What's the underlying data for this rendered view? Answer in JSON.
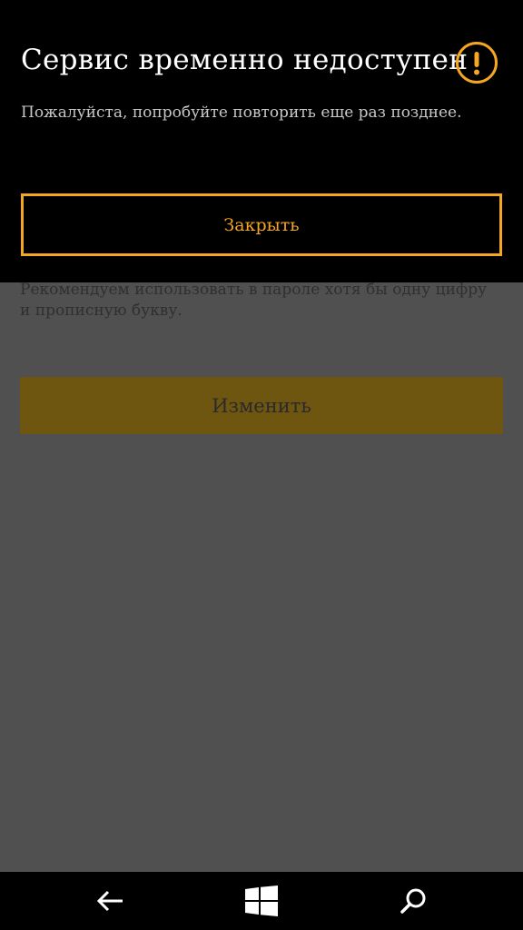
{
  "background_page": {
    "hint_text": "Рекомендуем использовать в пароле хотя бы одну цифру и прописную букву.",
    "change_button_label": "Изменить"
  },
  "dialog": {
    "title": "Сервис временно недоступен",
    "message": "Пожалуйста, попробуйте повторить еще раз позднее.",
    "icon": "warning-icon",
    "close_button_label": "Закрыть",
    "accent_color": "#f5a623"
  },
  "nav_bar": {
    "items": [
      {
        "icon": "back-arrow-icon"
      },
      {
        "icon": "windows-logo-icon"
      },
      {
        "icon": "search-icon"
      }
    ]
  }
}
